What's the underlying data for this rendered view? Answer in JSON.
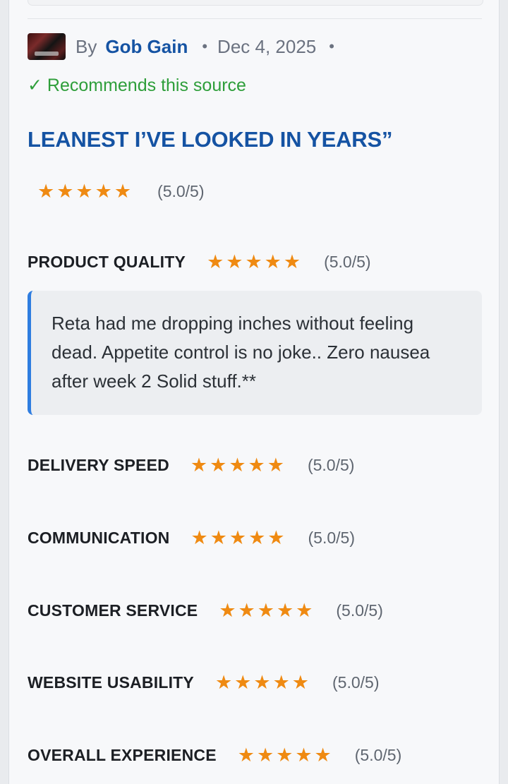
{
  "review": {
    "by_label": "By",
    "author": "Gob Gain",
    "date": "Dec 4, 2025",
    "recommendation": "✓ Recommends this source",
    "headline": "LEANEST I’VE LOOKED IN YEARS”",
    "overall": {
      "stars": "★★★★★",
      "score": "(5.0/5)",
      "value": 5.0
    },
    "comment": "Reta had me dropping inches without feeling dead. Appetite control is no joke.. Zero nausea after week 2 Solid stuff.**",
    "categories": [
      {
        "label": "PRODUCT QUALITY",
        "stars": "★★★★★",
        "score": "(5.0/5)",
        "value": 5.0
      },
      {
        "label": "DELIVERY SPEED",
        "stars": "★★★★★",
        "score": "(5.0/5)",
        "value": 5.0
      },
      {
        "label": "COMMUNICATION",
        "stars": "★★★★★",
        "score": "(5.0/5)",
        "value": 5.0
      },
      {
        "label": "CUSTOMER SERVICE",
        "stars": "★★★★★",
        "score": "(5.0/5)",
        "value": 5.0
      },
      {
        "label": "WEBSITE USABILITY",
        "stars": "★★★★★",
        "score": "(5.0/5)",
        "value": 5.0
      },
      {
        "label": "OVERALL EXPERIENCE",
        "stars": "★★★★★",
        "score": "(5.0/5)",
        "value": 5.0
      }
    ]
  },
  "colors": {
    "accent": "#1553a3",
    "recommend": "#2e9e3a",
    "star": "#ef8a12",
    "quote_border": "#2f7de0"
  },
  "icons": {
    "avatar": "user-avatar-photo",
    "star": "star-icon"
  }
}
